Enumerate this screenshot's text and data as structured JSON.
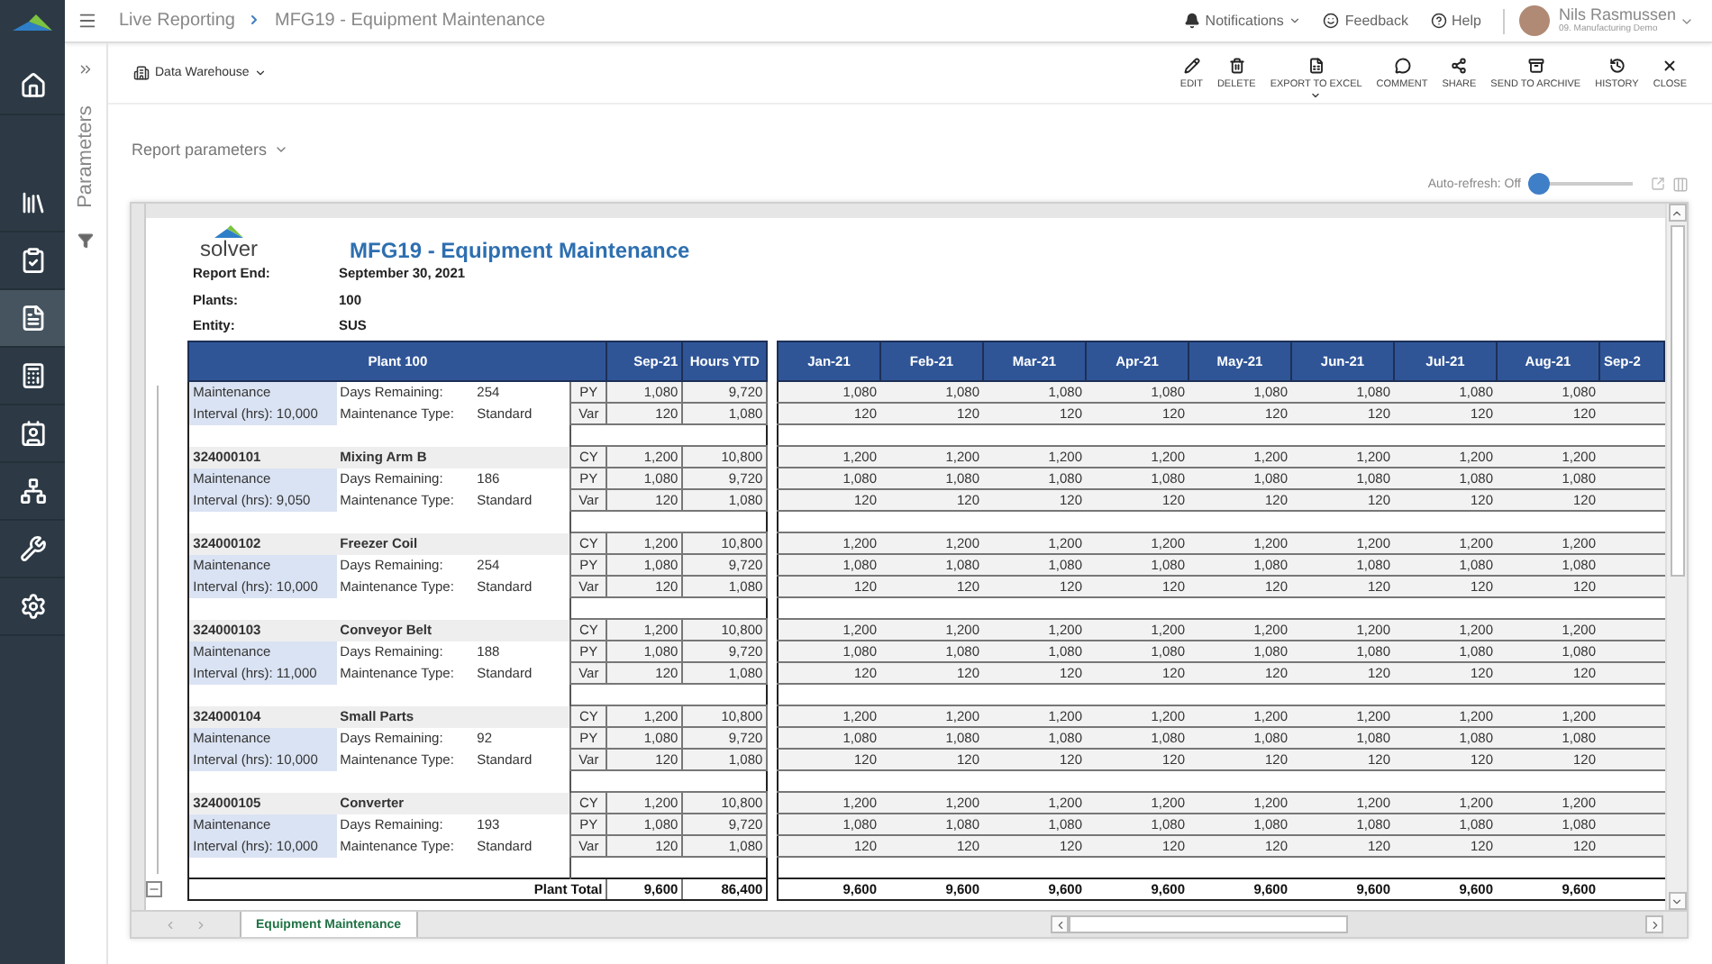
{
  "nav": [
    {
      "selected": false
    },
    {
      "selected": false
    },
    {
      "selected": false
    },
    {
      "selected": true
    },
    {
      "selected": false
    },
    {
      "selected": false
    },
    {
      "selected": false
    },
    {
      "selected": false
    },
    {
      "selected": false
    }
  ],
  "breadcrumb": [
    "Live Reporting",
    "MFG19 - Equipment Maintenance"
  ],
  "header_links": [
    {
      "label": "Notifications",
      "dropdown": true
    },
    {
      "label": "Feedback",
      "dropdown": false
    },
    {
      "label": "Help",
      "dropdown": false
    }
  ],
  "user": {
    "name": "Nils Rasmussen",
    "company": "09. Manufacturing Demo"
  },
  "parameters_panel": {
    "title": "Parameters"
  },
  "source": {
    "label": "Data Warehouse"
  },
  "actions": [
    {
      "label": "EDIT",
      "dropdown": false
    },
    {
      "label": "DELETE",
      "dropdown": false
    },
    {
      "label": "EXPORT TO EXCEL",
      "dropdown": true
    },
    {
      "label": "COMMENT",
      "dropdown": false
    },
    {
      "label": "SHARE",
      "dropdown": false
    },
    {
      "label": "SEND TO ARCHIVE",
      "dropdown": false
    },
    {
      "label": "HISTORY",
      "dropdown": false
    },
    {
      "label": "CLOSE",
      "dropdown": false
    }
  ],
  "report_parameters": {
    "label": "Report parameters"
  },
  "auto_refresh": {
    "label": "Auto-refresh: Off",
    "on": false
  },
  "report": {
    "logo": "solver",
    "title": "MFG19 - Equipment Maintenance",
    "params": [
      {
        "label": "Report End:",
        "value": "September 30, 2021"
      },
      {
        "label": "Plants:",
        "value": "100"
      },
      {
        "label": "Entity:",
        "value": "SUS"
      }
    ],
    "columns": {
      "group": "Plant 100",
      "sep": "Sep-21",
      "ytd": "Hours YTD",
      "months": [
        "Jan-21",
        "Feb-21",
        "Mar-21",
        "Apr-21",
        "May-21",
        "Jun-21",
        "Jul-21",
        "Aug-21",
        "Sep-2"
      ]
    },
    "items": [
      {
        "maintenance": "Maintenance",
        "interval": "Interval (hrs): 10,000",
        "days_label": "Days Remaining:",
        "days": "254",
        "type_label": "Maintenance Type:",
        "type": "Standard",
        "rows": [
          {
            "label": "PY",
            "sep": "1,080",
            "ytd": "9,720",
            "months": [
              "1,080",
              "1,080",
              "1,080",
              "1,080",
              "1,080",
              "1,080",
              "1,080",
              "1,080"
            ]
          },
          {
            "label": "Var",
            "sep": "120",
            "ytd": "1,080",
            "months": [
              "120",
              "120",
              "120",
              "120",
              "120",
              "120",
              "120",
              "120"
            ]
          }
        ]
      },
      {
        "id": "324000101",
        "name": "Mixing Arm B",
        "maintenance": "Maintenance",
        "interval": "Interval (hrs): 9,050",
        "days_label": "Days Remaining:",
        "days": "186",
        "type_label": "Maintenance Type:",
        "type": "Standard",
        "rows": [
          {
            "label": "CY",
            "sep": "1,200",
            "ytd": "10,800",
            "months": [
              "1,200",
              "1,200",
              "1,200",
              "1,200",
              "1,200",
              "1,200",
              "1,200",
              "1,200"
            ]
          },
          {
            "label": "PY",
            "sep": "1,080",
            "ytd": "9,720",
            "months": [
              "1,080",
              "1,080",
              "1,080",
              "1,080",
              "1,080",
              "1,080",
              "1,080",
              "1,080"
            ]
          },
          {
            "label": "Var",
            "sep": "120",
            "ytd": "1,080",
            "months": [
              "120",
              "120",
              "120",
              "120",
              "120",
              "120",
              "120",
              "120"
            ]
          }
        ]
      },
      {
        "id": "324000102",
        "name": "Freezer Coil",
        "maintenance": "Maintenance",
        "interval": "Interval (hrs): 10,000",
        "days_label": "Days Remaining:",
        "days": "254",
        "type_label": "Maintenance Type:",
        "type": "Standard",
        "rows": [
          {
            "label": "CY",
            "sep": "1,200",
            "ytd": "10,800",
            "months": [
              "1,200",
              "1,200",
              "1,200",
              "1,200",
              "1,200",
              "1,200",
              "1,200",
              "1,200"
            ]
          },
          {
            "label": "PY",
            "sep": "1,080",
            "ytd": "9,720",
            "months": [
              "1,080",
              "1,080",
              "1,080",
              "1,080",
              "1,080",
              "1,080",
              "1,080",
              "1,080"
            ]
          },
          {
            "label": "Var",
            "sep": "120",
            "ytd": "1,080",
            "months": [
              "120",
              "120",
              "120",
              "120",
              "120",
              "120",
              "120",
              "120"
            ]
          }
        ]
      },
      {
        "id": "324000103",
        "name": "Conveyor Belt",
        "maintenance": "Maintenance",
        "interval": "Interval (hrs): 11,000",
        "days_label": "Days Remaining:",
        "days": "188",
        "type_label": "Maintenance Type:",
        "type": "Standard",
        "rows": [
          {
            "label": "CY",
            "sep": "1,200",
            "ytd": "10,800",
            "months": [
              "1,200",
              "1,200",
              "1,200",
              "1,200",
              "1,200",
              "1,200",
              "1,200",
              "1,200"
            ]
          },
          {
            "label": "PY",
            "sep": "1,080",
            "ytd": "9,720",
            "months": [
              "1,080",
              "1,080",
              "1,080",
              "1,080",
              "1,080",
              "1,080",
              "1,080",
              "1,080"
            ]
          },
          {
            "label": "Var",
            "sep": "120",
            "ytd": "1,080",
            "months": [
              "120",
              "120",
              "120",
              "120",
              "120",
              "120",
              "120",
              "120"
            ]
          }
        ]
      },
      {
        "id": "324000104",
        "name": "Small Parts",
        "maintenance": "Maintenance",
        "interval": "Interval (hrs): 10,000",
        "days_label": "Days Remaining:",
        "days": "92",
        "type_label": "Maintenance Type:",
        "type": "Standard",
        "rows": [
          {
            "label": "CY",
            "sep": "1,200",
            "ytd": "10,800",
            "months": [
              "1,200",
              "1,200",
              "1,200",
              "1,200",
              "1,200",
              "1,200",
              "1,200",
              "1,200"
            ]
          },
          {
            "label": "PY",
            "sep": "1,080",
            "ytd": "9,720",
            "months": [
              "1,080",
              "1,080",
              "1,080",
              "1,080",
              "1,080",
              "1,080",
              "1,080",
              "1,080"
            ]
          },
          {
            "label": "Var",
            "sep": "120",
            "ytd": "1,080",
            "months": [
              "120",
              "120",
              "120",
              "120",
              "120",
              "120",
              "120",
              "120"
            ]
          }
        ]
      },
      {
        "id": "324000105",
        "name": "Converter",
        "maintenance": "Maintenance",
        "interval": "Interval (hrs): 10,000",
        "days_label": "Days Remaining:",
        "days": "193",
        "type_label": "Maintenance Type:",
        "type": "Standard",
        "rows": [
          {
            "label": "CY",
            "sep": "1,200",
            "ytd": "10,800",
            "months": [
              "1,200",
              "1,200",
              "1,200",
              "1,200",
              "1,200",
              "1,200",
              "1,200",
              "1,200"
            ]
          },
          {
            "label": "PY",
            "sep": "1,080",
            "ytd": "9,720",
            "months": [
              "1,080",
              "1,080",
              "1,080",
              "1,080",
              "1,080",
              "1,080",
              "1,080",
              "1,080"
            ]
          },
          {
            "label": "Var",
            "sep": "120",
            "ytd": "1,080",
            "months": [
              "120",
              "120",
              "120",
              "120",
              "120",
              "120",
              "120",
              "120"
            ]
          }
        ]
      }
    ],
    "total": {
      "label": "Plant Total",
      "sep": "9,600",
      "ytd": "86,400",
      "months": [
        "9,600",
        "9,600",
        "9,600",
        "9,600",
        "9,600",
        "9,600",
        "9,600",
        "9,600"
      ]
    }
  },
  "sheet_tabs": [
    {
      "label": "Equipment Maintenance",
      "selected": true
    }
  ]
}
